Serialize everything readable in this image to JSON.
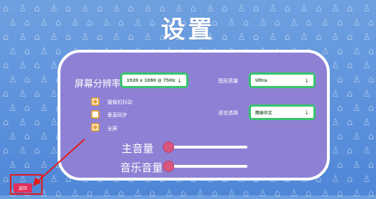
{
  "title": "设置",
  "resolution": {
    "label": "屏幕分辨率",
    "value": "1920 x 1080 @ 75Hz",
    "arrow": "↓"
  },
  "graphics": {
    "label": "图形质量",
    "value": "Ultra",
    "arrow": "↓"
  },
  "language": {
    "label": "语言选择",
    "value": "简体中文",
    "arrow": "↓"
  },
  "options": [
    {
      "label": "摄像机抖动",
      "checked": true
    },
    {
      "label": "垂直同步",
      "checked": false
    },
    {
      "label": "全屏",
      "checked": true
    }
  ],
  "master_volume": {
    "label": "主音量",
    "level": 0.0
  },
  "music_volume": {
    "label": "音乐音量",
    "level": 0.0
  },
  "back_button": {
    "label": "返回"
  },
  "colors": {
    "panel": "#8e81d5",
    "dropdown_border": "#37c46b",
    "checkbox": "#e6a13c",
    "slider_knob": "#d9567e",
    "back_button": "#e2305a",
    "annotation": "#e01b1b"
  },
  "icons": [
    "house-outline-icon",
    "tshirt-icon",
    "arrow-down-icon",
    "annotation-arrow-icon"
  ]
}
